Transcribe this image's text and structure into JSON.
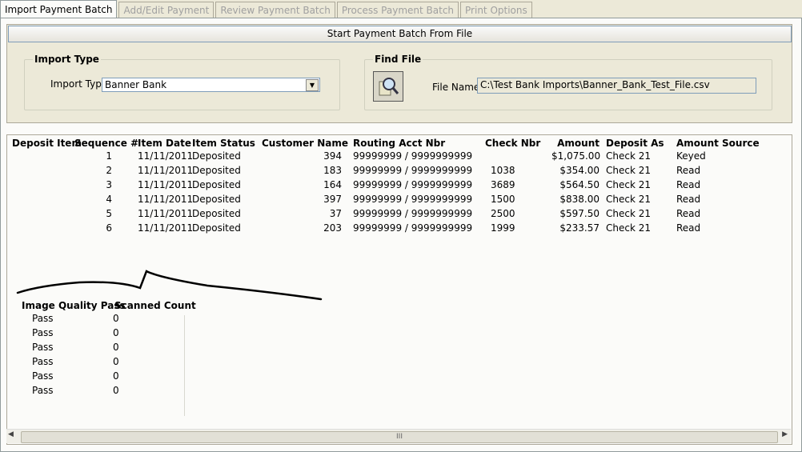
{
  "tabs": [
    "Import Payment Batch",
    "Add/Edit Payment",
    "Review Payment Batch",
    "Process Payment Batch",
    "Print Options"
  ],
  "start_button": "Start Payment Batch From File",
  "import_type": {
    "legend": "Import Type",
    "label": "Import Type:",
    "value": "Banner Bank"
  },
  "find_file": {
    "legend": "Find File",
    "label": "File Name:",
    "value": "C:\\Test Bank Imports\\Banner_Bank_Test_File.csv"
  },
  "payments": {
    "headers": [
      "Deposit Item",
      "Sequence #",
      "Item Date",
      "Item Status",
      "Customer Name",
      "Routing Acct Nbr",
      "Check Nbr",
      "Amount",
      "Deposit As",
      "Amount Source"
    ],
    "rows": [
      [
        "",
        "1",
        "11/11/2011",
        "Deposited",
        "394",
        "99999999 / 9999999999",
        "",
        "$1,075.00",
        "Check 21",
        "Keyed"
      ],
      [
        "",
        "2",
        "11/11/2011",
        "Deposited",
        "183",
        "99999999 / 9999999999",
        "1038",
        "$354.00",
        "Check 21",
        "Read"
      ],
      [
        "",
        "3",
        "11/11/2011",
        "Deposited",
        "164",
        "99999999 / 9999999999",
        "3689",
        "$564.50",
        "Check 21",
        "Read"
      ],
      [
        "",
        "4",
        "11/11/2011",
        "Deposited",
        "397",
        "99999999 / 9999999999",
        "1500",
        "$838.00",
        "Check 21",
        "Read"
      ],
      [
        "",
        "5",
        "11/11/2011",
        "Deposited",
        "37",
        "99999999 / 9999999999",
        "2500",
        "$597.50",
        "Check 21",
        "Read"
      ],
      [
        "",
        "6",
        "11/11/2011",
        "Deposited",
        "203",
        "99999999 / 9999999999",
        "1999",
        "$233.57",
        "Check 21",
        "Read"
      ]
    ]
  },
  "quality": {
    "headers": [
      "Image Quality Pass",
      "Scanned Count"
    ],
    "rows": [
      [
        "Pass",
        "0"
      ],
      [
        "Pass",
        "0"
      ],
      [
        "Pass",
        "0"
      ],
      [
        "Pass",
        "0"
      ],
      [
        "Pass",
        "0"
      ],
      [
        "Pass",
        "0"
      ]
    ]
  },
  "scroll_grip": "III"
}
